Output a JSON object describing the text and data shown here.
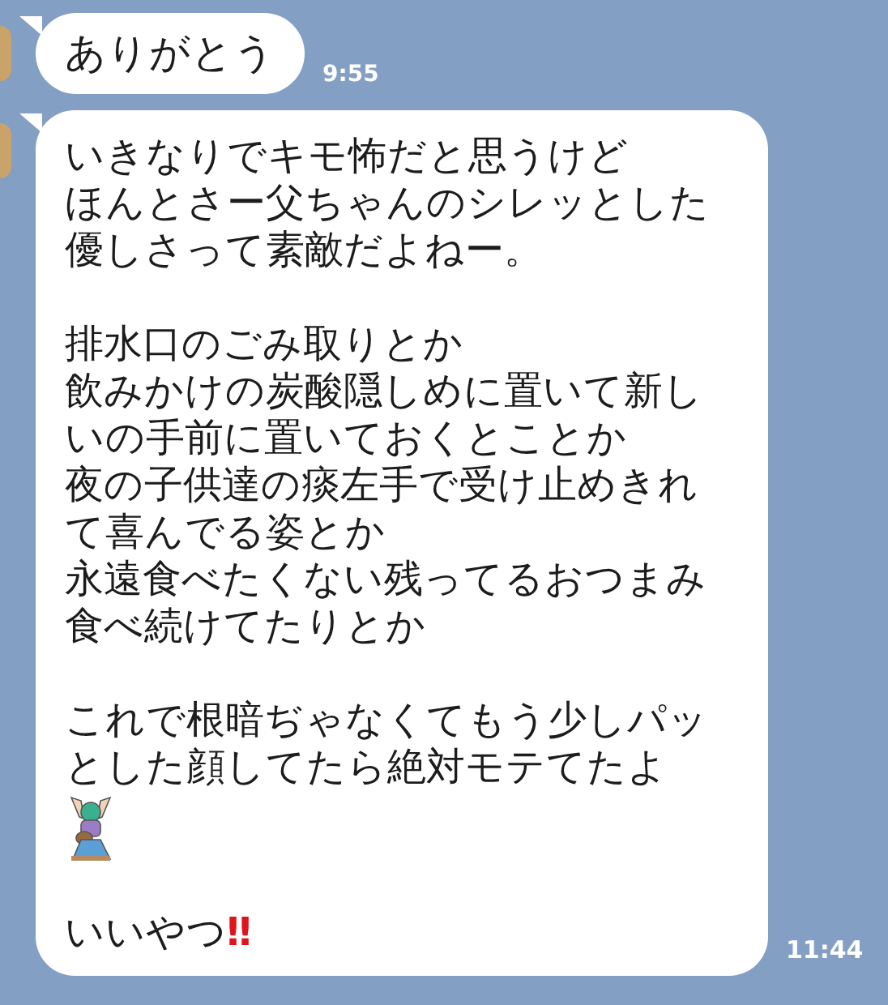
{
  "messages": [
    {
      "blocks": [
        {
          "kind": "text",
          "text": "ありがとう"
        }
      ],
      "time": "9:55"
    },
    {
      "blocks": [
        {
          "kind": "paragraph",
          "lines": [
            "いきなりでキモ怖だと思うけど",
            "ほんとさー父ちゃんのシレッとした優しさって素敵だよねー。"
          ]
        },
        {
          "kind": "paragraph",
          "lines": [
            "排水口のごみ取りとか",
            "飲みかけの炭酸隠しめに置いて新しいの手前に置いておくとことか",
            "夜の子供達の痰左手で受け止めきれて喜んでる姿とか",
            "永遠食べたくない残ってるおつまみ食べ続けてたりとか"
          ]
        },
        {
          "kind": "paragraph",
          "lines": [
            "これで根暗ぢゃなくてもう少しパッとした顔してたら絶対モテてたよ"
          ]
        },
        {
          "kind": "sticker"
        },
        {
          "kind": "text",
          "text": "いいやつ",
          "mark": "‼"
        }
      ],
      "time": "11:44"
    }
  ]
}
